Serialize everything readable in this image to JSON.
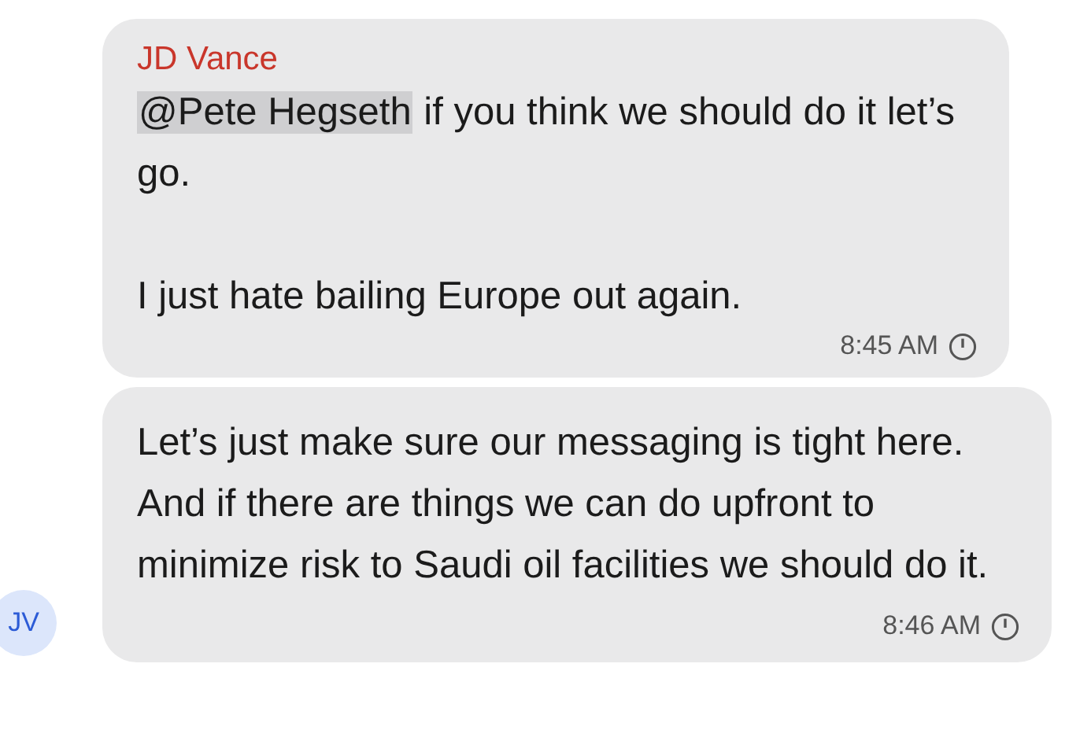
{
  "messages": [
    {
      "sender": "JD Vance",
      "paragraphs": [
        {
          "mention": "@Pete Hegseth",
          "text": " if you think we should do it let’s go."
        },
        {
          "text": "I just hate bailing Europe out again."
        }
      ],
      "time": "8:45 AM"
    },
    {
      "avatar": "JV",
      "paragraphs": [
        {
          "text": "Let’s just make sure our messaging is tight here. And if there are things we can do upfront to minimize risk to Saudi oil facilities we should do it."
        }
      ],
      "time": "8:46 AM"
    }
  ]
}
